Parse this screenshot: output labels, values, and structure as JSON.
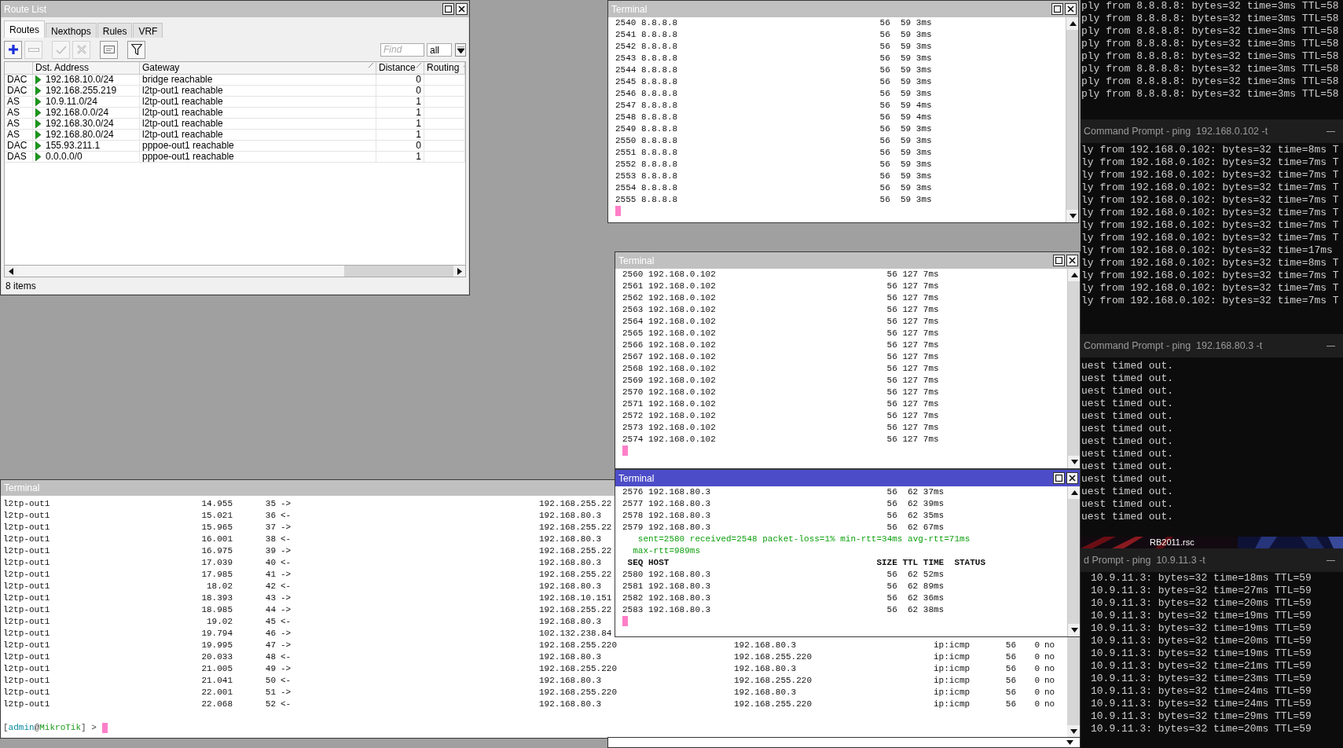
{
  "route_list": {
    "title": "Route List",
    "tabs": [
      {
        "label": "Routes",
        "selected": true
      },
      {
        "label": "Nexthops",
        "selected": false
      },
      {
        "label": "Rules",
        "selected": false
      },
      {
        "label": "VRF",
        "selected": false
      }
    ],
    "toolbar": [
      {
        "kind": "add",
        "disabled": false
      },
      {
        "kind": "remove",
        "disabled": true
      },
      {
        "kind": "enable",
        "disabled": true
      },
      {
        "kind": "disable",
        "disabled": true
      },
      {
        "kind": "comment",
        "disabled": false
      },
      {
        "kind": "filter",
        "disabled": false
      }
    ],
    "find_placeholder": "Find",
    "filter": "all",
    "columns": [
      {
        "label": "Dst. Address",
        "sorted": false
      },
      {
        "label": "Gateway",
        "sorted": true
      },
      {
        "label": "Distance",
        "sorted": true
      },
      {
        "label": "Routing",
        "sorted": false
      }
    ],
    "rows": [
      {
        "flags": "DAC",
        "dst": "192.168.10.0/24",
        "gateway": "bridge reachable",
        "distance": "0"
      },
      {
        "flags": "DAC",
        "dst": "192.168.255.219",
        "gateway": "l2tp-out1 reachable",
        "distance": "0"
      },
      {
        "flags": "AS",
        "dst": "10.9.11.0/24",
        "gateway": "l2tp-out1 reachable",
        "distance": "1"
      },
      {
        "flags": "AS",
        "dst": "192.168.0.0/24",
        "gateway": "l2tp-out1 reachable",
        "distance": "1"
      },
      {
        "flags": "AS",
        "dst": "192.168.30.0/24",
        "gateway": "l2tp-out1 reachable",
        "distance": "1"
      },
      {
        "flags": "AS",
        "dst": "192.168.80.0/24",
        "gateway": "l2tp-out1 reachable",
        "distance": "1"
      },
      {
        "flags": "DAC",
        "dst": "155.93.211.1",
        "gateway": "pppoe-out1 reachable",
        "distance": "0"
      },
      {
        "flags": "DAS",
        "dst": "0.0.0.0/0",
        "gateway": "pppoe-out1 reachable",
        "distance": "1"
      }
    ],
    "status": "8 items"
  },
  "terminals": [
    {
      "title": "Terminal",
      "active": false,
      "lines": [
        {
          "kind": "ping",
          "cells": [
            "2540",
            "8.8.8.8",
            "56",
            "59",
            "3ms"
          ]
        },
        {
          "kind": "ping",
          "cells": [
            "2541",
            "8.8.8.8",
            "56",
            "59",
            "3ms"
          ]
        },
        {
          "kind": "ping",
          "cells": [
            "2542",
            "8.8.8.8",
            "56",
            "59",
            "3ms"
          ]
        },
        {
          "kind": "ping",
          "cells": [
            "2543",
            "8.8.8.8",
            "56",
            "59",
            "3ms"
          ]
        },
        {
          "kind": "ping",
          "cells": [
            "2544",
            "8.8.8.8",
            "56",
            "59",
            "3ms"
          ]
        },
        {
          "kind": "ping",
          "cells": [
            "2545",
            "8.8.8.8",
            "56",
            "59",
            "3ms"
          ]
        },
        {
          "kind": "ping",
          "cells": [
            "2546",
            "8.8.8.8",
            "56",
            "59",
            "3ms"
          ]
        },
        {
          "kind": "ping",
          "cells": [
            "2547",
            "8.8.8.8",
            "56",
            "59",
            "4ms"
          ]
        },
        {
          "kind": "ping",
          "cells": [
            "2548",
            "8.8.8.8",
            "56",
            "59",
            "4ms"
          ]
        },
        {
          "kind": "ping",
          "cells": [
            "2549",
            "8.8.8.8",
            "56",
            "59",
            "3ms"
          ]
        },
        {
          "kind": "ping",
          "cells": [
            "2550",
            "8.8.8.8",
            "56",
            "59",
            "3ms"
          ]
        },
        {
          "kind": "ping",
          "cells": [
            "2551",
            "8.8.8.8",
            "56",
            "59",
            "3ms"
          ]
        },
        {
          "kind": "ping",
          "cells": [
            "2552",
            "8.8.8.8",
            "56",
            "59",
            "3ms"
          ]
        },
        {
          "kind": "ping",
          "cells": [
            "2553",
            "8.8.8.8",
            "56",
            "59",
            "3ms"
          ]
        },
        {
          "kind": "ping",
          "cells": [
            "2554",
            "8.8.8.8",
            "56",
            "59",
            "3ms"
          ]
        },
        {
          "kind": "ping",
          "cells": [
            "2555",
            "8.8.8.8",
            "56",
            "59",
            "3ms"
          ]
        }
      ]
    },
    {
      "title": "Terminal",
      "active": false,
      "lines": [
        {
          "kind": "ping",
          "cells": [
            "2560",
            "192.168.0.102",
            "56",
            "127",
            "7ms"
          ]
        },
        {
          "kind": "ping",
          "cells": [
            "2561",
            "192.168.0.102",
            "56",
            "127",
            "7ms"
          ]
        },
        {
          "kind": "ping",
          "cells": [
            "2562",
            "192.168.0.102",
            "56",
            "127",
            "7ms"
          ]
        },
        {
          "kind": "ping",
          "cells": [
            "2563",
            "192.168.0.102",
            "56",
            "127",
            "7ms"
          ]
        },
        {
          "kind": "ping",
          "cells": [
            "2564",
            "192.168.0.102",
            "56",
            "127",
            "7ms"
          ]
        },
        {
          "kind": "ping",
          "cells": [
            "2565",
            "192.168.0.102",
            "56",
            "127",
            "7ms"
          ]
        },
        {
          "kind": "ping",
          "cells": [
            "2566",
            "192.168.0.102",
            "56",
            "127",
            "7ms"
          ]
        },
        {
          "kind": "ping",
          "cells": [
            "2567",
            "192.168.0.102",
            "56",
            "127",
            "7ms"
          ]
        },
        {
          "kind": "ping",
          "cells": [
            "2568",
            "192.168.0.102",
            "56",
            "127",
            "7ms"
          ]
        },
        {
          "kind": "ping",
          "cells": [
            "2569",
            "192.168.0.102",
            "56",
            "127",
            "7ms"
          ]
        },
        {
          "kind": "ping",
          "cells": [
            "2570",
            "192.168.0.102",
            "56",
            "127",
            "7ms"
          ]
        },
        {
          "kind": "ping",
          "cells": [
            "2571",
            "192.168.0.102",
            "56",
            "127",
            "7ms"
          ]
        },
        {
          "kind": "ping",
          "cells": [
            "2572",
            "192.168.0.102",
            "56",
            "127",
            "7ms"
          ]
        },
        {
          "kind": "ping",
          "cells": [
            "2573",
            "192.168.0.102",
            "56",
            "127",
            "7ms"
          ]
        },
        {
          "kind": "ping",
          "cells": [
            "2574",
            "192.168.0.102",
            "56",
            "127",
            "7ms"
          ]
        }
      ]
    },
    {
      "title": "Terminal",
      "active": true,
      "lines": [
        {
          "kind": "ping",
          "cells": [
            "2576",
            "192.168.80.3",
            "56",
            "62",
            "37ms"
          ]
        },
        {
          "kind": "ping",
          "cells": [
            "2577",
            "192.168.80.3",
            "56",
            "62",
            "39ms"
          ]
        },
        {
          "kind": "ping",
          "cells": [
            "2578",
            "192.168.80.3",
            "56",
            "62",
            "35ms"
          ]
        },
        {
          "kind": "ping",
          "cells": [
            "2579",
            "192.168.80.3",
            "56",
            "62",
            "67ms"
          ]
        },
        {
          "kind": "stats",
          "text": "sent=2580 received=2548 packet-loss=1% min-rtt=34ms avg-rtt=71ms"
        },
        {
          "kind": "stats_wrap",
          "text": "max-rtt=989ms"
        },
        {
          "kind": "header",
          "cells": [
            "SEQ",
            "HOST",
            "SIZE",
            "TTL",
            "TIME",
            "STATUS"
          ]
        },
        {
          "kind": "ping",
          "cells": [
            "2580",
            "192.168.80.3",
            "56",
            "62",
            "52ms"
          ]
        },
        {
          "kind": "ping",
          "cells": [
            "2581",
            "192.168.80.3",
            "56",
            "62",
            "89ms"
          ]
        },
        {
          "kind": "ping",
          "cells": [
            "2582",
            "192.168.80.3",
            "56",
            "62",
            "36ms"
          ]
        },
        {
          "kind": "ping",
          "cells": [
            "2583",
            "192.168.80.3",
            "56",
            "62",
            "38ms"
          ]
        }
      ]
    }
  ],
  "sniffer_terminal": {
    "title": "Terminal",
    "lines": [
      [
        "l2tp-out1",
        "14.955",
        "35",
        "->",
        "192.168.255.22"
      ],
      [
        "l2tp-out1",
        "15.021",
        "36",
        "<-",
        "192.168.80.3"
      ],
      [
        "l2tp-out1",
        "15.965",
        "37",
        "->",
        "192.168.255.22"
      ],
      [
        "l2tp-out1",
        "16.001",
        "38",
        "<-",
        "192.168.80.3"
      ],
      [
        "l2tp-out1",
        "16.975",
        "39",
        "->",
        "192.168.255.22"
      ],
      [
        "l2tp-out1",
        "17.039",
        "40",
        "<-",
        "192.168.80.3"
      ],
      [
        "l2tp-out1",
        "17.985",
        "41",
        "->",
        "192.168.255.22"
      ],
      [
        "l2tp-out1",
        "18.02",
        "42",
        "<-",
        "192.168.80.3"
      ],
      [
        "l2tp-out1",
        "18.393",
        "43",
        "->",
        "192.168.10.151"
      ],
      [
        "l2tp-out1",
        "18.985",
        "44",
        "->",
        "192.168.255.22"
      ],
      [
        "l2tp-out1",
        "19.02",
        "45",
        "<-",
        "192.168.80.3"
      ],
      [
        "l2tp-out1",
        "19.794",
        "46",
        "->",
        "102.132.238.84"
      ],
      [
        "l2tp-out1",
        "19.995",
        "47",
        "->",
        "192.168.255.220",
        "192.168.80.3",
        "ip:icmp",
        "56",
        "0",
        "no"
      ],
      [
        "l2tp-out1",
        "20.033",
        "48",
        "<-",
        "192.168.80.3",
        "192.168.255.220",
        "ip:icmp",
        "56",
        "0",
        "no"
      ],
      [
        "l2tp-out1",
        "21.005",
        "49",
        "->",
        "192.168.255.220",
        "192.168.80.3",
        "ip:icmp",
        "56",
        "0",
        "no"
      ],
      [
        "l2tp-out1",
        "21.041",
        "50",
        "<-",
        "192.168.80.3",
        "192.168.255.220",
        "ip:icmp",
        "56",
        "0",
        "no"
      ],
      [
        "l2tp-out1",
        "22.001",
        "51",
        "->",
        "192.168.255.220",
        "192.168.80.3",
        "ip:icmp",
        "56",
        "0",
        "no"
      ],
      [
        "l2tp-out1",
        "22.068",
        "52",
        "<-",
        "192.168.80.3",
        "192.168.255.220",
        "ip:icmp",
        "56",
        "0",
        "no"
      ]
    ],
    "prompt": [
      {
        "kind": "punct",
        "text": "["
      },
      {
        "kind": "user",
        "text": "admin"
      },
      {
        "kind": "punct",
        "text": "@"
      },
      {
        "kind": "host",
        "text": "MikroTik"
      },
      {
        "kind": "punct",
        "text": "] >"
      }
    ]
  },
  "cmd_windows": [
    {
      "lines": [
        "ply from 8.8.8.8: bytes=32 time=3ms TTL=58",
        "ply from 8.8.8.8: bytes=32 time=3ms TTL=58",
        "ply from 8.8.8.8: bytes=32 time=3ms TTL=58",
        "ply from 8.8.8.8: bytes=32 time=3ms TTL=58",
        "ply from 8.8.8.8: bytes=32 time=3ms TTL=58",
        "ply from 8.8.8.8: bytes=32 time=3ms TTL=58",
        "ply from 8.8.8.8: bytes=32 time=3ms TTL=58",
        "ply from 8.8.8.8: bytes=32 time=3ms TTL=58"
      ]
    },
    {
      "title": "Command Prompt - ping  192.168.0.102 -t",
      "lines": [
        "ly from 192.168.0.102: bytes=32 time=8ms T",
        "ly from 192.168.0.102: bytes=32 time=7ms T",
        "ly from 192.168.0.102: bytes=32 time=7ms T",
        "ly from 192.168.0.102: bytes=32 time=7ms T",
        "ly from 192.168.0.102: bytes=32 time=7ms T",
        "ly from 192.168.0.102: bytes=32 time=7ms T",
        "ly from 192.168.0.102: bytes=32 time=7ms T",
        "ly from 192.168.0.102: bytes=32 time=7ms T",
        "ly from 192.168.0.102: bytes=32 time=17ms",
        "ly from 192.168.0.102: bytes=32 time=8ms T",
        "ly from 192.168.0.102: bytes=32 time=7ms T",
        "ly from 192.168.0.102: bytes=32 time=7ms T",
        "ly from 192.168.0.102: bytes=32 time=7ms T"
      ]
    },
    {
      "title": "Command Prompt - ping  192.168.80.3 -t",
      "lines": [
        "uest timed out.",
        "uest timed out.",
        "uest timed out.",
        "uest timed out.",
        "uest timed out.",
        "uest timed out.",
        "uest timed out.",
        "uest timed out.",
        "uest timed out.",
        "uest timed out.",
        "uest timed out.",
        "uest timed out.",
        "uest timed out."
      ]
    },
    {
      "title": "d Prompt - ping  10.9.11.3 -t",
      "lines": [
        "10.9.11.3: bytes=32 time=18ms TTL=59",
        "10.9.11.3: bytes=32 time=27ms TTL=59",
        "10.9.11.3: bytes=32 time=20ms TTL=59",
        "10.9.11.3: bytes=32 time=19ms TTL=59",
        "10.9.11.3: bytes=32 time=19ms TTL=59",
        "10.9.11.3: bytes=32 time=20ms TTL=59",
        "10.9.11.3: bytes=32 time=19ms TTL=59",
        "10.9.11.3: bytes=32 time=21ms TTL=59",
        "10.9.11.3: bytes=32 time=23ms TTL=59",
        "10.9.11.3: bytes=32 time=24ms TTL=59",
        "10.9.11.3: bytes=32 time=24ms TTL=59",
        "10.9.11.3: bytes=32 time=29ms TTL=59",
        "10.9.11.3: bytes=32 time=20ms TTL=59"
      ]
    }
  ],
  "desktop_icon": {
    "label": "RB2011.rsc"
  }
}
